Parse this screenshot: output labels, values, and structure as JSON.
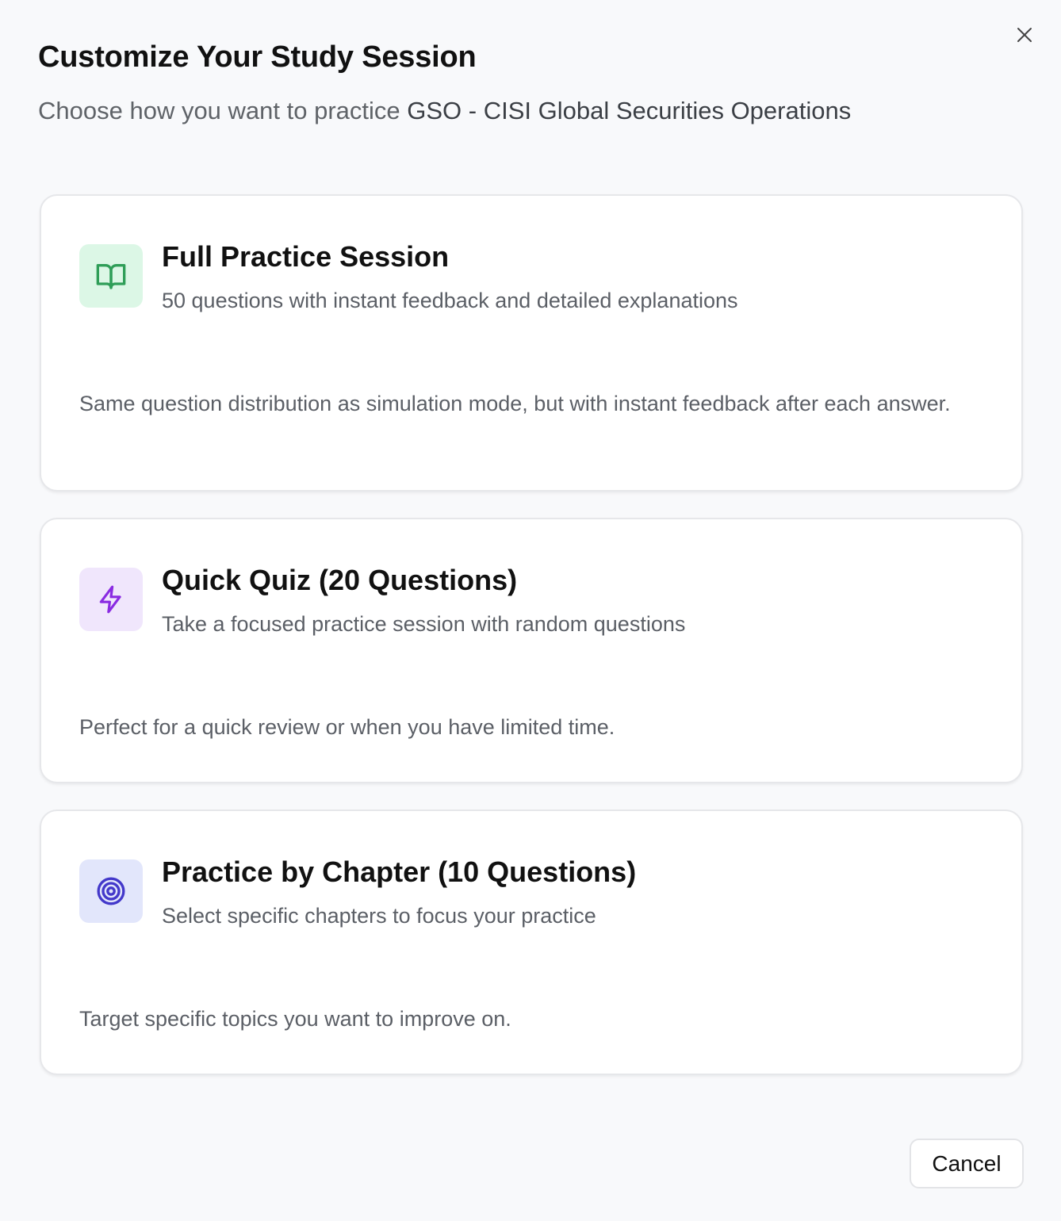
{
  "dialog": {
    "title": "Customize Your Study Session",
    "subtitle_prefix": "Choose how you want to practice ",
    "course_name": "GSO - CISI Global Securities Operations",
    "close_icon": "close-icon"
  },
  "options": [
    {
      "title": "Full Practice Session",
      "subtitle": "50 questions with instant feedback and detailed explanations",
      "description": "Same question distribution as simulation mode, but with instant feedback after each answer.",
      "icon": "book-open-icon",
      "icon_color": "#2f9e58",
      "icon_bg": "#dcf7e6"
    },
    {
      "title": "Quick Quiz (20 Questions)",
      "subtitle": "Take a focused practice session with random questions",
      "description": "Perfect for a quick review or when you have limited time.",
      "icon": "lightning-icon",
      "icon_color": "#8a2be2",
      "icon_bg": "#f0e6fc"
    },
    {
      "title": "Practice by Chapter (10 Questions)",
      "subtitle": "Select specific chapters to focus your practice",
      "description": "Target specific topics you want to improve on.",
      "icon": "target-icon",
      "icon_color": "#4338ca",
      "icon_bg": "#e2e6fb"
    }
  ],
  "footer": {
    "cancel_label": "Cancel"
  }
}
